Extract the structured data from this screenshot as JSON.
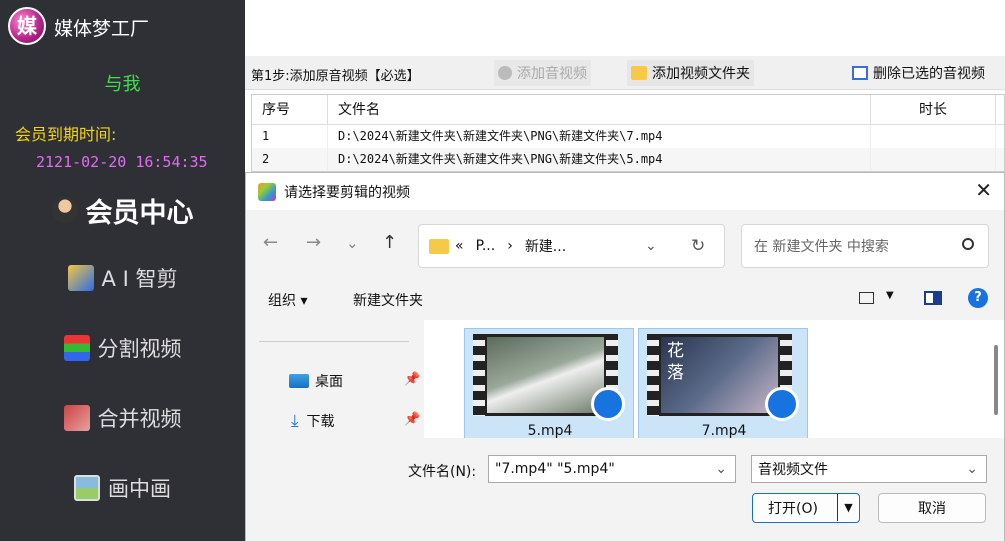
{
  "app": {
    "title": "媒体梦工厂",
    "logo_char": "媒"
  },
  "sidebar": {
    "user": "与我",
    "expire_label": "会员到期时间:",
    "expire_date": "2121-02-20 16:54:35",
    "menu": [
      {
        "label": "会员中心",
        "icon": "vip-avatar-icon"
      },
      {
        "label": "A I 智剪",
        "icon": "ai-edit-icon"
      },
      {
        "label": "分割视频",
        "icon": "split-video-icon"
      },
      {
        "label": "合并视频",
        "icon": "merge-video-icon"
      },
      {
        "label": "画中画",
        "icon": "picture-in-picture-icon"
      }
    ]
  },
  "toolbar": {
    "step": "第1步:添加原音视频【必选】",
    "add_media": "添加音视频",
    "add_folder": "添加视频文件夹",
    "delete_selected": "删除已选的音视频"
  },
  "table": {
    "headers": [
      "序号",
      "文件名",
      "时长"
    ],
    "rows": [
      [
        "1",
        "D:\\2024\\新建文件夹\\新建文件夹\\PNG\\新建文件夹\\7.mp4",
        ""
      ],
      [
        "2",
        "D:\\2024\\新建文件夹\\新建文件夹\\PNG\\新建文件夹\\5.mp4",
        ""
      ]
    ]
  },
  "dialog": {
    "title": "请选择要剪辑的视频",
    "close": "✕",
    "nav": {
      "back": "←",
      "forward": "→",
      "recent": "⌄",
      "up": "↑"
    },
    "address": {
      "chevrons": "«",
      "crumb1": "P...",
      "sep": "›",
      "crumb2": "新建...",
      "dropdown": "⌄",
      "refresh": "↻"
    },
    "search_placeholder": "在 新建文件夹 中搜索",
    "commands": {
      "organize": "组织 ▾",
      "new_folder": "新建文件夹",
      "help": "?"
    },
    "nav_items": [
      {
        "label": "桌面",
        "icon": "desktop-icon"
      },
      {
        "label": "下载",
        "icon": "download-icon"
      }
    ],
    "files": [
      {
        "name": "5.mp4"
      },
      {
        "name": "7.mp4",
        "overlay": "花\n落"
      }
    ],
    "filename_label": "文件名(N):",
    "filename_value": "\"7.mp4\" \"5.mp4\"",
    "filetype": "音视频文件",
    "open": "打开(O)",
    "cancel": "取消"
  }
}
